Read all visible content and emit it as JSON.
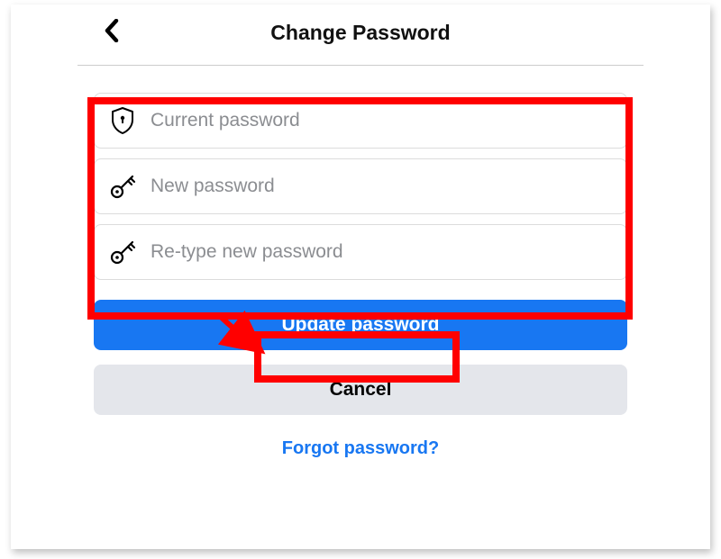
{
  "header": {
    "title": "Change Password"
  },
  "fields": {
    "current": {
      "placeholder": "Current password"
    },
    "newpw": {
      "placeholder": "New password"
    },
    "retype": {
      "placeholder": "Re-type new password"
    }
  },
  "buttons": {
    "update": "Update password",
    "cancel": "Cancel"
  },
  "links": {
    "forgot": "Forgot password?"
  },
  "colors": {
    "primary": "#1877f2",
    "secondary_bg": "#e4e6eb",
    "highlight": "#ff0000"
  }
}
